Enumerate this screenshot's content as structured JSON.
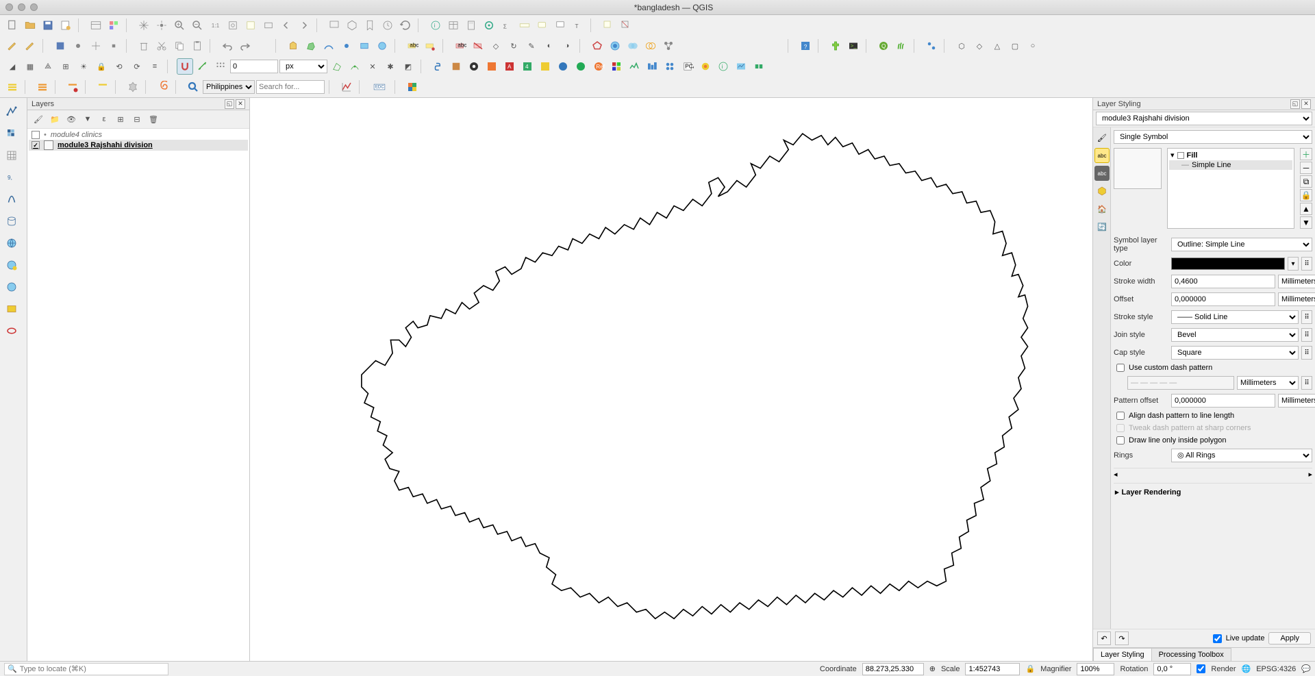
{
  "window": {
    "title": "*bangladesh — QGIS"
  },
  "toolbar_row4": {
    "num_value": "0",
    "unit": "px",
    "country": "Philippines",
    "search_placeholder": "Search for..."
  },
  "panels": {
    "layers": {
      "title": "Layers"
    },
    "layer_styling": {
      "title": "Layer Styling"
    }
  },
  "layers": {
    "items": [
      {
        "name": "module4 clinics",
        "visible": false,
        "selected": false,
        "italic": true
      },
      {
        "name": "module3 Rajshahi division",
        "visible": true,
        "selected": true,
        "italic": false
      }
    ]
  },
  "styling": {
    "layer": "module3 Rajshahi division",
    "symbol_type": "Single Symbol",
    "tree": {
      "root": "Fill",
      "child": "Simple Line"
    },
    "layer_type_label": "Symbol layer type",
    "layer_type": "Outline: Simple Line",
    "color_label": "Color",
    "stroke_width_label": "Stroke width",
    "stroke_width": "0,4600",
    "stroke_width_unit": "Millimeters",
    "offset_label": "Offset",
    "offset": "0,000000",
    "offset_unit": "Millimeters",
    "stroke_style_label": "Stroke style",
    "stroke_style": "Solid Line",
    "join_style_label": "Join style",
    "join_style": "Bevel",
    "cap_style_label": "Cap style",
    "cap_style": "Square",
    "custom_dash_label": "Use custom dash pattern",
    "dash_unit": "Millimeters",
    "pattern_offset_label": "Pattern offset",
    "pattern_offset": "0,000000",
    "pattern_offset_unit": "Millimeters",
    "align_dash_label": "Align dash pattern to line length",
    "tweak_dash_label": "Tweak dash pattern at sharp corners",
    "inside_polygon_label": "Draw line only inside polygon",
    "rings_label": "Rings",
    "rings": "All Rings",
    "layer_rendering_label": "Layer Rendering",
    "live_update_label": "Live update",
    "apply_label": "Apply"
  },
  "tabs": {
    "layer_styling": "Layer Styling",
    "processing": "Processing Toolbox"
  },
  "statusbar": {
    "locator_placeholder": "Type to locate (⌘K)",
    "coordinate_label": "Coordinate",
    "coordinate": "88.273,25.330",
    "scale_label": "Scale",
    "scale": "1:452743",
    "magnifier_label": "Magnifier",
    "magnifier": "100%",
    "rotation_label": "Rotation",
    "rotation": "0,0 °",
    "render_label": "Render",
    "crs": "EPSG:4326"
  }
}
